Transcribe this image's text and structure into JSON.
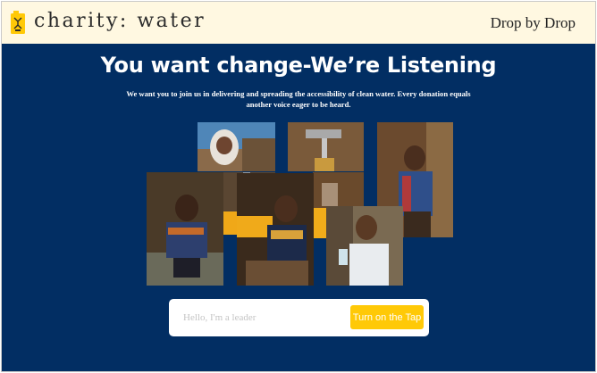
{
  "colors": {
    "header_bg": "#fff8e1",
    "main_bg": "#022e63",
    "accent": "#ffc907",
    "text_dark": "#222222",
    "text_light": "#ffffff"
  },
  "header": {
    "logo_icon": "jerrycan-icon",
    "logo_text": "charity: water",
    "tagline": "Drop by Drop"
  },
  "main": {
    "headline": "You want change-We’re Listening",
    "subtext": "We want you to join us in delivering and spreading the accessibility of clean water. Every donation equals another voice eager to be heard."
  },
  "gallery": {
    "photos": [
      "photo-woman-smiling",
      "photo-water-tap",
      "photo-boy-drinking",
      "photo-child-washing-face",
      "photo-girl-at-tap",
      "photo-yellow-jerrycans",
      "photo-boy-with-glass"
    ]
  },
  "signup": {
    "placeholder": "Hello, I'm a leader",
    "button_label": "Turn on the Tap"
  }
}
